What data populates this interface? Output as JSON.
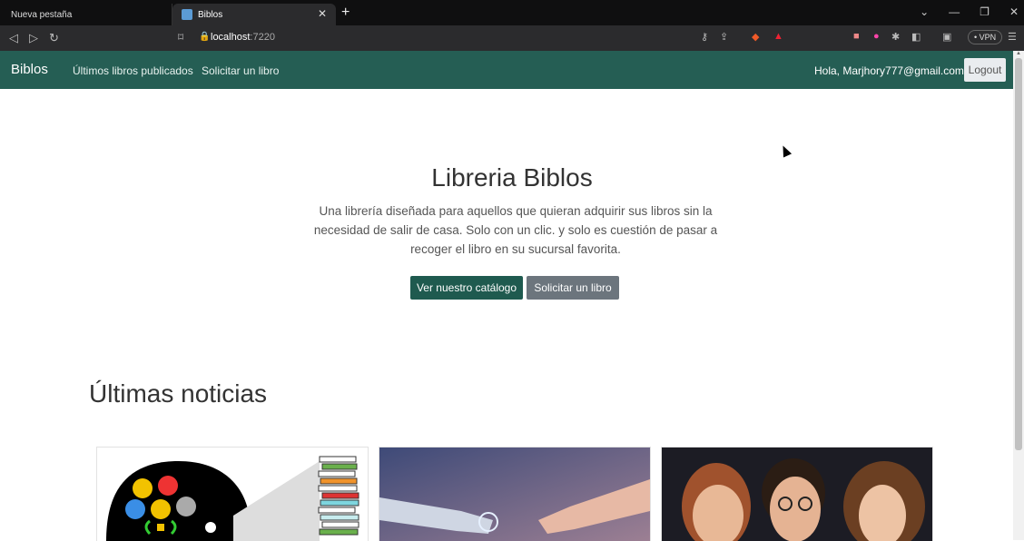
{
  "browser": {
    "tabs": [
      {
        "label": "Nueva pestaña"
      },
      {
        "label": "Biblos"
      }
    ],
    "url_host": "localhost",
    "url_port": ":7220",
    "vpn_label": "• VPN"
  },
  "nav": {
    "brand": "Biblos",
    "links": [
      "Últimos libros publicados",
      "Solicitar un libro"
    ],
    "greeting": "Hola, Marjhory777@gmail.com",
    "logout": "Logout"
  },
  "hero": {
    "title": "Libreria Biblos",
    "description": "Una librería diseñada para aquellos que quieran adquirir sus libros sin la necesidad de salir de casa. Solo con un clic. y solo es cuestión de pasar a recoger el libro en su sucursal favorita.",
    "primary_button": "Ver nuestro catálogo",
    "secondary_button": "Solicitar un libro"
  },
  "news": {
    "title": "Últimas noticias",
    "cards": [
      {
        "image": "brain-books-illustration"
      },
      {
        "image": "robot-human-hands"
      },
      {
        "image": "harry-potter-characters"
      }
    ]
  },
  "colors": {
    "navbar": "#255e54",
    "primary_button": "#1f5a4f",
    "secondary_button": "#6c757d"
  }
}
